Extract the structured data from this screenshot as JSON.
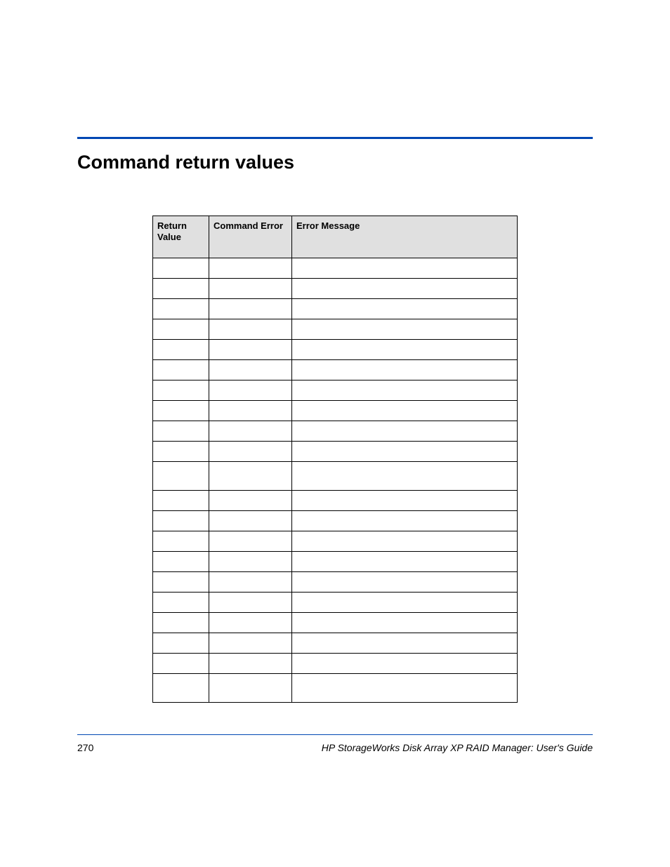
{
  "section_title": "Command return values",
  "table": {
    "headers": {
      "col1_line1": "Return",
      "col1_line2": "Value",
      "col2": "Command Error",
      "col3": "Error Message"
    },
    "rows": [
      {
        "return_value": "",
        "command_error": "",
        "error_message": "",
        "tall": false
      },
      {
        "return_value": "",
        "command_error": "",
        "error_message": "",
        "tall": false
      },
      {
        "return_value": "",
        "command_error": "",
        "error_message": "",
        "tall": false
      },
      {
        "return_value": "",
        "command_error": "",
        "error_message": "",
        "tall": false
      },
      {
        "return_value": "",
        "command_error": "",
        "error_message": "",
        "tall": false
      },
      {
        "return_value": "",
        "command_error": "",
        "error_message": "",
        "tall": false
      },
      {
        "return_value": "",
        "command_error": "",
        "error_message": "",
        "tall": false
      },
      {
        "return_value": "",
        "command_error": "",
        "error_message": "",
        "tall": false
      },
      {
        "return_value": "",
        "command_error": "",
        "error_message": "",
        "tall": false
      },
      {
        "return_value": "",
        "command_error": "",
        "error_message": "",
        "tall": false
      },
      {
        "return_value": "",
        "command_error": "",
        "error_message": "",
        "tall": true
      },
      {
        "return_value": "",
        "command_error": "",
        "error_message": "",
        "tall": false
      },
      {
        "return_value": "",
        "command_error": "",
        "error_message": "",
        "tall": false
      },
      {
        "return_value": "",
        "command_error": "",
        "error_message": "",
        "tall": false
      },
      {
        "return_value": "",
        "command_error": "",
        "error_message": "",
        "tall": false
      },
      {
        "return_value": "",
        "command_error": "",
        "error_message": "",
        "tall": false
      },
      {
        "return_value": "",
        "command_error": "",
        "error_message": "",
        "tall": false
      },
      {
        "return_value": "",
        "command_error": "",
        "error_message": "",
        "tall": false
      },
      {
        "return_value": "",
        "command_error": "",
        "error_message": "",
        "tall": false
      },
      {
        "return_value": "",
        "command_error": "",
        "error_message": "",
        "tall": false
      },
      {
        "return_value": "",
        "command_error": "",
        "error_message": "",
        "tall": true
      }
    ]
  },
  "footer": {
    "page_number": "270",
    "doc_title": "HP StorageWorks Disk Array XP RAID Manager: User's Guide"
  }
}
